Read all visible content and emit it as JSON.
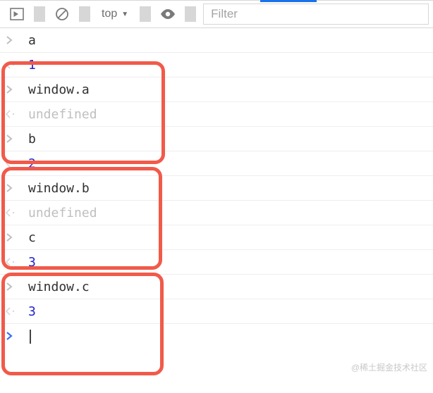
{
  "toolbar": {
    "context_label": "top",
    "filter_placeholder": "Filter",
    "filter_value": ""
  },
  "icons": {
    "toggle": "toggle-console-icon",
    "clear": "clear-console-icon",
    "dropdown": "▼",
    "eye": "live-expressions-icon"
  },
  "entries": [
    {
      "kind": "input",
      "text": "a"
    },
    {
      "kind": "output",
      "valueType": "number",
      "text": "1"
    },
    {
      "kind": "input",
      "text": "window.a"
    },
    {
      "kind": "output",
      "valueType": "undefined",
      "text": "undefined"
    },
    {
      "kind": "input",
      "text": "b"
    },
    {
      "kind": "output",
      "valueType": "number",
      "text": "2"
    },
    {
      "kind": "input",
      "text": "window.b"
    },
    {
      "kind": "output",
      "valueType": "undefined",
      "text": "undefined"
    },
    {
      "kind": "input",
      "text": "c"
    },
    {
      "kind": "output",
      "valueType": "number",
      "text": "3"
    },
    {
      "kind": "input",
      "text": "window.c"
    },
    {
      "kind": "output",
      "valueType": "number",
      "text": "3"
    }
  ],
  "watermark": "@稀土掘金技术社区"
}
